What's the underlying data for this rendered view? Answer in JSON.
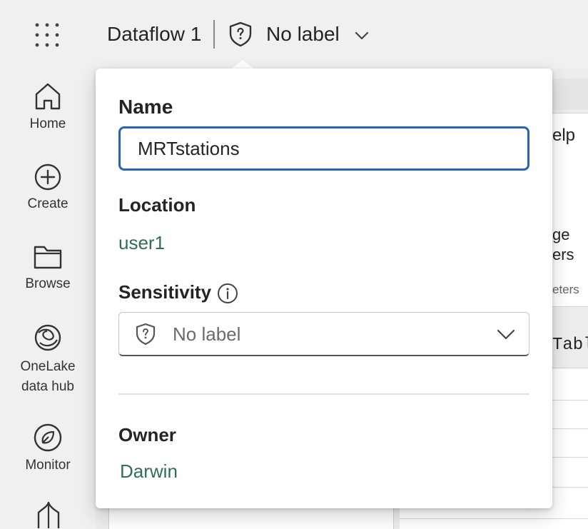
{
  "header": {
    "title": "Dataflow 1",
    "sensitivity_label": "No label"
  },
  "nav": {
    "items": [
      {
        "label": "Home"
      },
      {
        "label": "Create"
      },
      {
        "label": "Browse"
      },
      {
        "label": "OneLake data hub"
      },
      {
        "label": "Monitor"
      }
    ],
    "onelake_line1": "OneLake",
    "onelake_line2": "data hub"
  },
  "background": {
    "ribbon_fragment_help": "elp",
    "ribbon_fragment_ge": "ge",
    "ribbon_fragment_ers": "ers",
    "ribbon_fragment_eters": "eters",
    "formula_fragment": "Tabl"
  },
  "popover": {
    "name_heading": "Name",
    "name_value": "MRTstations",
    "location_heading": "Location",
    "location_value": "user1",
    "sensitivity_heading": "Sensitivity",
    "sensitivity_value": "No label",
    "owner_heading": "Owner",
    "owner_value": "Darwin"
  },
  "colors": {
    "accent_focus": "#2563bd",
    "link_green": "#2f6f5a"
  }
}
